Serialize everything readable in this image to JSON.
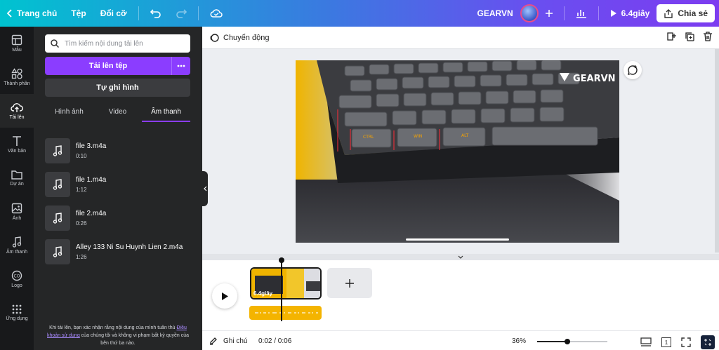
{
  "topbar": {
    "home_label": "Trang chủ",
    "file_label": "Tệp",
    "resize_label": "Đổi cỡ",
    "project_name": "GEARVN",
    "play_label": "6.4giây",
    "share_label": "Chia sẻ"
  },
  "rail": {
    "items": [
      {
        "label": "Mẫu",
        "icon": "template-icon"
      },
      {
        "label": "Thành phần",
        "icon": "elements-icon"
      },
      {
        "label": "Tải lên",
        "icon": "upload-cloud-icon"
      },
      {
        "label": "Văn bản",
        "icon": "text-icon"
      },
      {
        "label": "Dự án",
        "icon": "folder-icon"
      },
      {
        "label": "Ảnh",
        "icon": "image-icon"
      },
      {
        "label": "Âm thanh",
        "icon": "music-icon"
      },
      {
        "label": "Logo",
        "icon": "logo-icon"
      },
      {
        "label": "Ứng dụng",
        "icon": "apps-icon"
      }
    ]
  },
  "panel": {
    "search_placeholder": "Tìm kiếm nội dung tải lên",
    "upload_label": "Tải lên tệp",
    "record_label": "Tự ghi hình",
    "tabs": [
      "Hình ảnh",
      "Video",
      "Âm thanh"
    ],
    "active_tab": "Âm thanh",
    "files": [
      {
        "name": "file 3.m4a",
        "duration": "0:10"
      },
      {
        "name": "file 1.m4a",
        "duration": "1:12"
      },
      {
        "name": "file 2.m4a",
        "duration": "0:26"
      },
      {
        "name": "Alley 133 Ni Su Huynh Lien 2.m4a",
        "duration": "1:26"
      }
    ],
    "footnote_before": "Khi tải lên, bạn xác nhận rằng nội dung của mình tuân thủ ",
    "footnote_link": "Điều khoản sử dụng",
    "footnote_after": " của chúng tôi và không vi phạm bất kỳ quyền của bên thứ ba nào."
  },
  "canvas": {
    "animate_label": "Chuyển động",
    "watermark": "GEARVN"
  },
  "timeline": {
    "clip_duration": "6.4giây",
    "playhead_fraction": 0.33
  },
  "footer": {
    "notes_label": "Ghi chú",
    "time": "0:02 / 0:06",
    "zoom": "36%",
    "zoom_fraction": 0.43,
    "page_count": "1"
  },
  "colors": {
    "accent": "#8b3dff",
    "audio": "#f4b400",
    "panel_bg": "#252627",
    "rail_bg": "#18191b"
  }
}
